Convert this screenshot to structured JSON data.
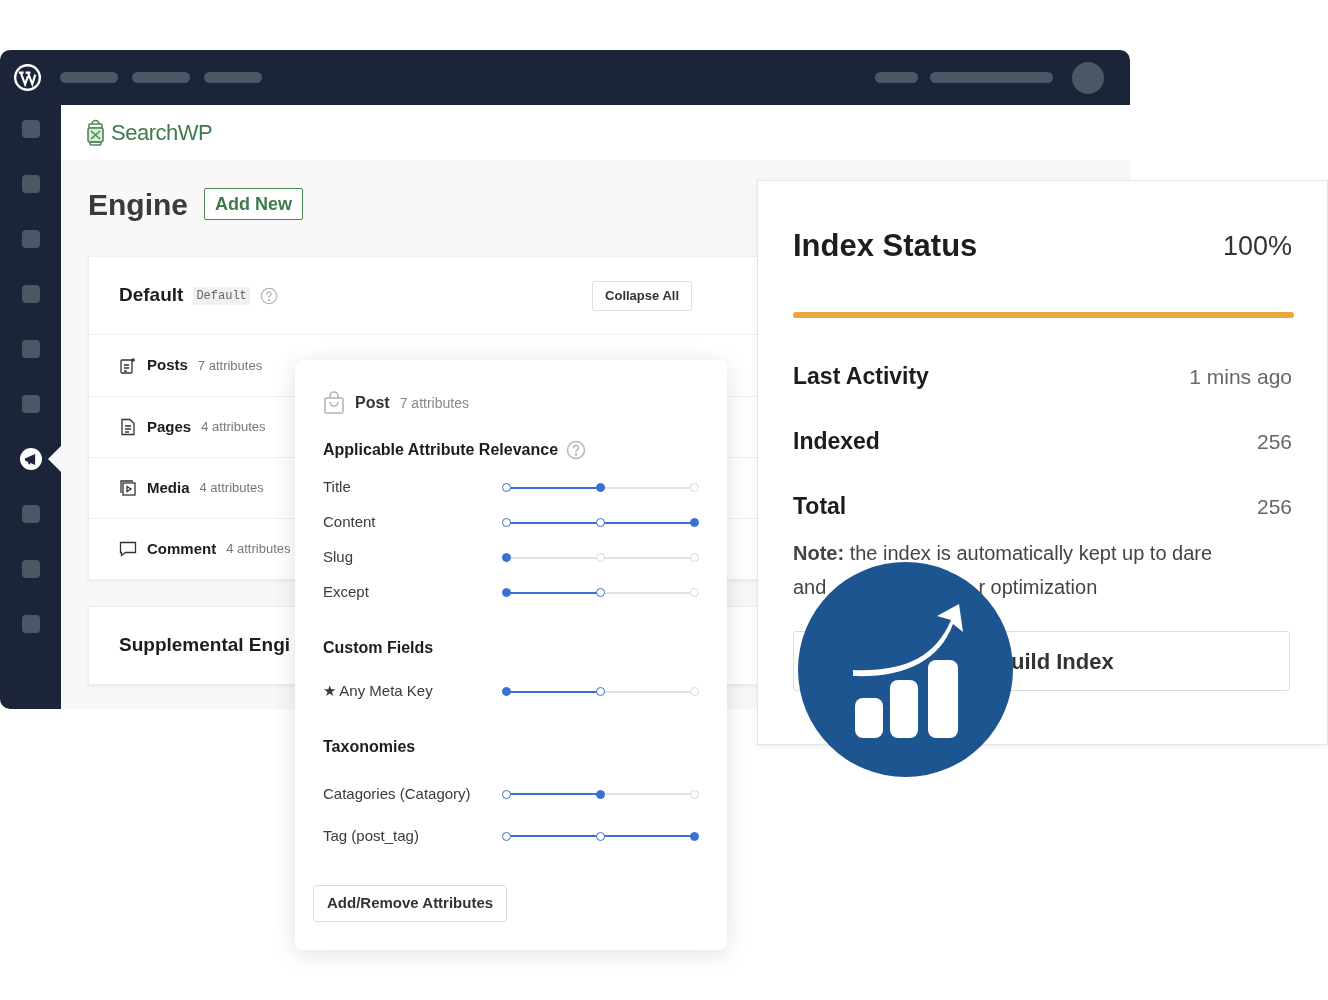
{
  "sidebar": {
    "items": [
      {
        "selected": false
      },
      {
        "selected": false
      },
      {
        "selected": false
      },
      {
        "selected": false
      },
      {
        "selected": false
      },
      {
        "selected": false
      },
      {
        "selected": true
      },
      {
        "selected": false
      },
      {
        "selected": false
      },
      {
        "selected": false
      }
    ]
  },
  "brand": {
    "name": "SearchWP"
  },
  "page": {
    "title": "Engine",
    "add_button": "Add New"
  },
  "engine_card": {
    "name": "Default",
    "tag": "Default",
    "collapse_button": "Collapse All",
    "sources": [
      {
        "kind": "posts",
        "label": "Posts",
        "count": "7 attributes"
      },
      {
        "kind": "pages",
        "label": "Pages",
        "count": "4 attributes"
      },
      {
        "kind": "media",
        "label": "Media",
        "count": "4 attributes"
      },
      {
        "kind": "comment",
        "label": "Comment",
        "count": "4 attributes"
      }
    ]
  },
  "supplemental": {
    "title": "Supplemental Engi"
  },
  "popup": {
    "source": "Post",
    "count": "7 attributes",
    "groups": [
      {
        "title": "Applicable Attribute Relevance",
        "help": true,
        "attributes": [
          {
            "label": "Title",
            "level": 0.5,
            "thumb_at_start": false
          },
          {
            "label": "Content",
            "level": 1,
            "thumb_at_start": false
          },
          {
            "label": "Slug",
            "level": 0
          },
          {
            "label": "Except",
            "level": 0.5,
            "thumb_at_start": true
          }
        ]
      },
      {
        "title": "Custom Fields",
        "help": false,
        "attributes": [
          {
            "label": "★ Any Meta Key",
            "level": 0.5,
            "thumb_at_start": true
          }
        ]
      },
      {
        "title": "Taxonomies",
        "help": false,
        "attributes": [
          {
            "label": "Catagories (Catagory)",
            "level": 0.5,
            "thumb_at_start": false
          },
          {
            "label": "Tag (post_tag)",
            "level": 1,
            "thumb_at_start": false
          }
        ]
      }
    ],
    "button": "Add/Remove Attributes"
  },
  "index_status": {
    "title": "Index Status",
    "percent": "100%",
    "level": 1,
    "stats": [
      {
        "label": "Last Activity",
        "value": "1 mins ago"
      },
      {
        "label": "Indexed",
        "value": "256"
      },
      {
        "label": "Total",
        "value": "256"
      }
    ],
    "note_line": "**Note:** the index is automatically kept up to dare",
    "note_start": "and",
    "note_end": "r optimization",
    "button": "uild Index"
  }
}
